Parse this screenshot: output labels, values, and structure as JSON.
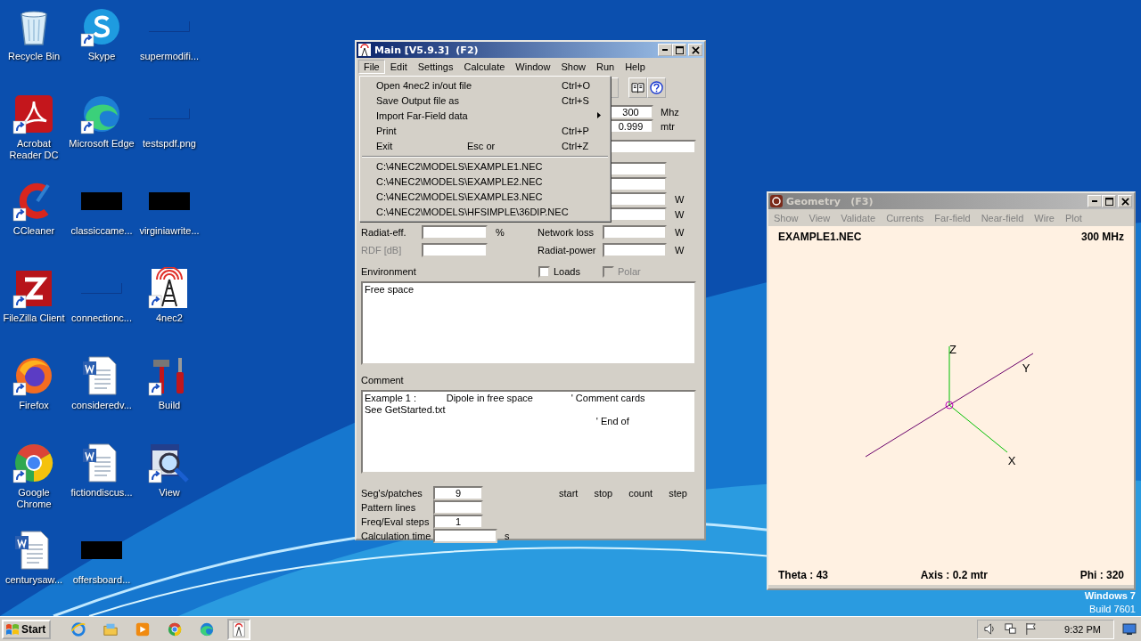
{
  "desktop": {
    "icons": [
      {
        "label": "Recycle Bin",
        "kind": "recycle",
        "shortcut": false
      },
      {
        "label": "Acrobat Reader DC",
        "kind": "acrobat",
        "shortcut": true
      },
      {
        "label": "CCleaner",
        "kind": "ccleaner",
        "shortcut": true
      },
      {
        "label": "FileZilla Client",
        "kind": "filezilla",
        "shortcut": true
      },
      {
        "label": "Firefox",
        "kind": "firefox",
        "shortcut": true
      },
      {
        "label": "Google Chrome",
        "kind": "chrome",
        "shortcut": true
      },
      {
        "label": "centurysaw...",
        "kind": "word",
        "shortcut": false
      },
      {
        "label": "Skype",
        "kind": "skype",
        "shortcut": true
      },
      {
        "label": "Microsoft Edge",
        "kind": "edge",
        "shortcut": true
      },
      {
        "label": "classiccame...",
        "kind": "redacted",
        "shortcut": false
      },
      {
        "label": "connectionc...",
        "kind": "blank",
        "shortcut": false
      },
      {
        "label": "consideredv...",
        "kind": "word",
        "shortcut": false
      },
      {
        "label": "fictiondiscus...",
        "kind": "word",
        "shortcut": false
      },
      {
        "label": "offersboard...",
        "kind": "redacted",
        "shortcut": false
      },
      {
        "label": "supermodifi...",
        "kind": "blank",
        "shortcut": false
      },
      {
        "label": "testspdf.png",
        "kind": "blank",
        "shortcut": false
      },
      {
        "label": "virginiawrite...",
        "kind": "redacted",
        "shortcut": false
      },
      {
        "label": "4nec2",
        "kind": "antenna",
        "shortcut": true
      },
      {
        "label": "Build",
        "kind": "tools",
        "shortcut": true
      },
      {
        "label": "View",
        "kind": "viewer",
        "shortcut": true
      }
    ],
    "os_label": [
      "Windows 7",
      "Build 7601"
    ]
  },
  "main_window": {
    "title": "Main [V5.9.3]  (F2)",
    "active": true,
    "menu": [
      {
        "label": "File",
        "selected": true
      },
      {
        "label": "Edit",
        "selected": false
      },
      {
        "label": "Settings",
        "selected": false
      },
      {
        "label": "Calculate",
        "selected": false
      },
      {
        "label": "Window",
        "selected": false
      },
      {
        "label": "Show",
        "selected": false
      },
      {
        "label": "Run",
        "selected": false
      },
      {
        "label": "Help",
        "selected": false
      }
    ],
    "file_menu": [
      {
        "kind": "item",
        "label": "Open 4nec2 in/out file",
        "shortcut": "Ctrl+O"
      },
      {
        "kind": "item",
        "label": "Save Output file as",
        "shortcut": "Ctrl+S"
      },
      {
        "kind": "submenu",
        "label": "Import Far-Field data"
      },
      {
        "kind": "item",
        "label": "Print",
        "shortcut": "Ctrl+P"
      },
      {
        "kind": "item",
        "label": "Exit",
        "note": "Esc or",
        "shortcut": "Ctrl+Z"
      },
      {
        "kind": "separator"
      },
      {
        "kind": "item",
        "label": "C:\\4NEC2\\MODELS\\EXAMPLE1.NEC"
      },
      {
        "kind": "item",
        "label": "C:\\4NEC2\\MODELS\\EXAMPLE2.NEC"
      },
      {
        "kind": "item",
        "label": "C:\\4NEC2\\MODELS\\EXAMPLE3.NEC"
      },
      {
        "kind": "item",
        "label": "C:\\4NEC2\\MODELS\\HFSIMPLE\\36DIP.NEC"
      }
    ],
    "toolbar": [
      {
        "kind": "blank"
      },
      {
        "kind": "book"
      },
      {
        "kind": "help"
      }
    ],
    "frequency": {
      "value": "300",
      "unit": "Mhz"
    },
    "wavelength": {
      "value": "0.999",
      "unit": "mtr"
    },
    "partial_fields": [
      {
        "kind": "wide"
      },
      {
        "kind": "short"
      },
      {
        "kind": "short"
      },
      {
        "kind": "short",
        "unit": "W"
      },
      {
        "kind": "short",
        "unit": "W"
      }
    ],
    "result_rows": [
      {
        "left_label": "Radiat-eff.",
        "left_disabled": false,
        "left_unit": "%",
        "right_label": "Network loss",
        "right_unit": "W"
      },
      {
        "left_label": "RDF [dB]",
        "left_disabled": true,
        "right_label": "Radiat-power",
        "right_unit": "W"
      }
    ],
    "environment": {
      "label": "Environment",
      "text": "Free space",
      "checkboxes": [
        {
          "label": "Loads",
          "checked": false,
          "disabled": false
        },
        {
          "label": "Polar",
          "checked": false,
          "disabled": true
        }
      ]
    },
    "comment": {
      "label": "Comment",
      "lines": [
        "Example 1 :           Dipole in free space              ' Comment cards",
        "See GetStarted.txt",
        "                                                                                     ' End of"
      ]
    },
    "stats": [
      {
        "label": "Seg's/patches",
        "value": "9",
        "kind": "short"
      },
      {
        "label": "Pattern lines",
        "kind": "short"
      },
      {
        "label": "Freq/Eval steps",
        "value": "1",
        "kind": "short"
      },
      {
        "label": "Calculation time",
        "kind": "long",
        "unit": "s"
      }
    ],
    "sweep_headers": [
      "start",
      "stop",
      "count",
      "step"
    ]
  },
  "geometry_window": {
    "title": "Geometry   (F3)",
    "active": false,
    "menu": [
      "Show",
      "View",
      "Validate",
      "Currents",
      "Far-field",
      "Near-field",
      "Wire",
      "Plot"
    ],
    "file": "EXAMPLE1.NEC",
    "frequency": "300 MHz",
    "axes": [
      {
        "kind": "z",
        "label": "Z"
      },
      {
        "kind": "y",
        "label": "Y"
      },
      {
        "kind": "x",
        "label": "X"
      }
    ],
    "theta": "Theta : 43",
    "axis_scale": "Axis : 0.2 mtr",
    "phi": "Phi : 320"
  },
  "taskbar": {
    "start_label": "Start",
    "pinned": [
      {
        "kind": "ie",
        "selected": false
      },
      {
        "kind": "folder",
        "selected": false
      },
      {
        "kind": "media",
        "selected": false
      },
      {
        "kind": "chrome",
        "selected": false
      },
      {
        "kind": "edge",
        "selected": false
      },
      {
        "kind": "antenna",
        "selected": true
      }
    ],
    "time": "9:32 PM"
  }
}
